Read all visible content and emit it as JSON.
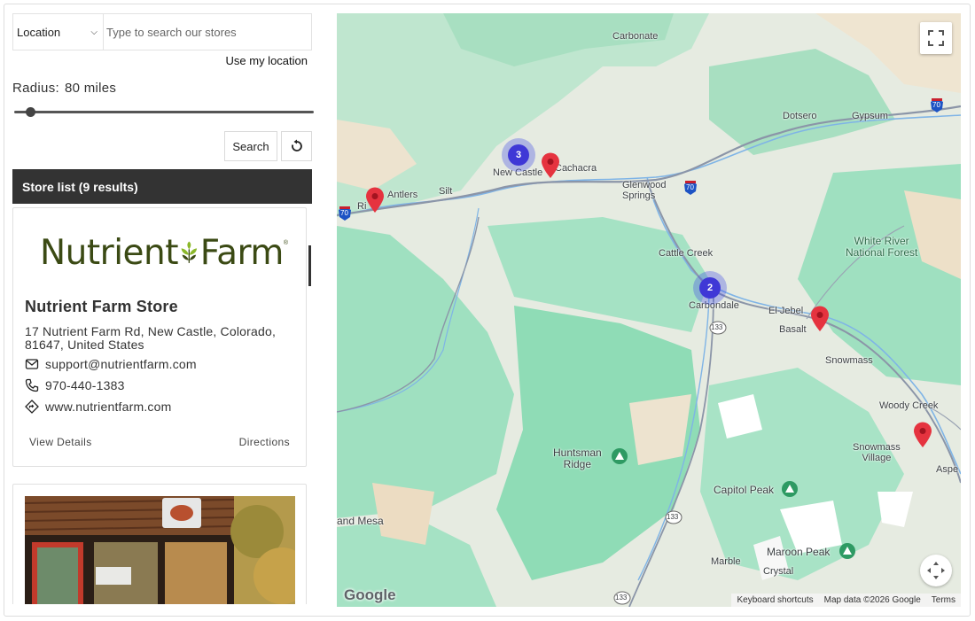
{
  "search": {
    "location_select": "Location",
    "placeholder": "Type to search our stores",
    "use_my_location": "Use my location"
  },
  "radius": {
    "label": "Radius:",
    "value": "80 miles",
    "slider_fraction": 0.05
  },
  "buttons": {
    "search": "Search",
    "reset_icon": "refresh-icon"
  },
  "store_list": {
    "header": "Store list (9 results)",
    "stores": [
      {
        "logo_text_1": "Nutrient",
        "logo_text_2": "Farm",
        "logo_mark": "®",
        "name": "Nutrient Farm Store",
        "address": "17 Nutrient Farm Rd, New Castle, Colorado, 81647, United States",
        "email": "support@nutrientfarm.com",
        "phone": "970-440-1383",
        "website": "www.nutrientfarm.com",
        "view_details": "View Details",
        "directions": "Directions"
      }
    ]
  },
  "map": {
    "places": {
      "carbonate": "Carbonate",
      "dotsero": "Dotsero",
      "gypsum": "Gypsum",
      "new_castle": "New Castle",
      "cachacra": "Cachacra",
      "silt": "Silt",
      "antlers": "Antlers",
      "rifle": "Ri",
      "glenwood": "Glenwood\nSprings",
      "cattle_creek": "Cattle Creek",
      "carbondale": "Carbondale",
      "el_jebel": "El Jebel",
      "basalt": "Basalt",
      "snowmass": "Snowmass",
      "woody_creek": "Woody Creek",
      "snowmass_village": "Snowmass\nVillage",
      "aspen": "Aspe",
      "white_river": "White River\nNational Forest",
      "huntsman_ridge": "Huntsman\nRidge",
      "capitol_peak": "Capitol Peak",
      "maroon_peak": "Maroon Peak",
      "marble": "Marble",
      "crystal": "Crystal",
      "grand_mesa": "and Mesa"
    },
    "highway_labels": {
      "i70": "70",
      "h133": "133"
    },
    "clusters": [
      {
        "count": "3"
      },
      {
        "count": "2"
      }
    ],
    "pin_color": "#e5333f",
    "cluster_color": "#3f38d6",
    "google_logo": "Google",
    "keyboard_shortcuts": "Keyboard shortcuts",
    "map_data": "Map data ©2026 Google",
    "terms": "Terms",
    "fullscreen_icon": "fullscreen-icon",
    "camera_icon": "camera-control-icon"
  }
}
